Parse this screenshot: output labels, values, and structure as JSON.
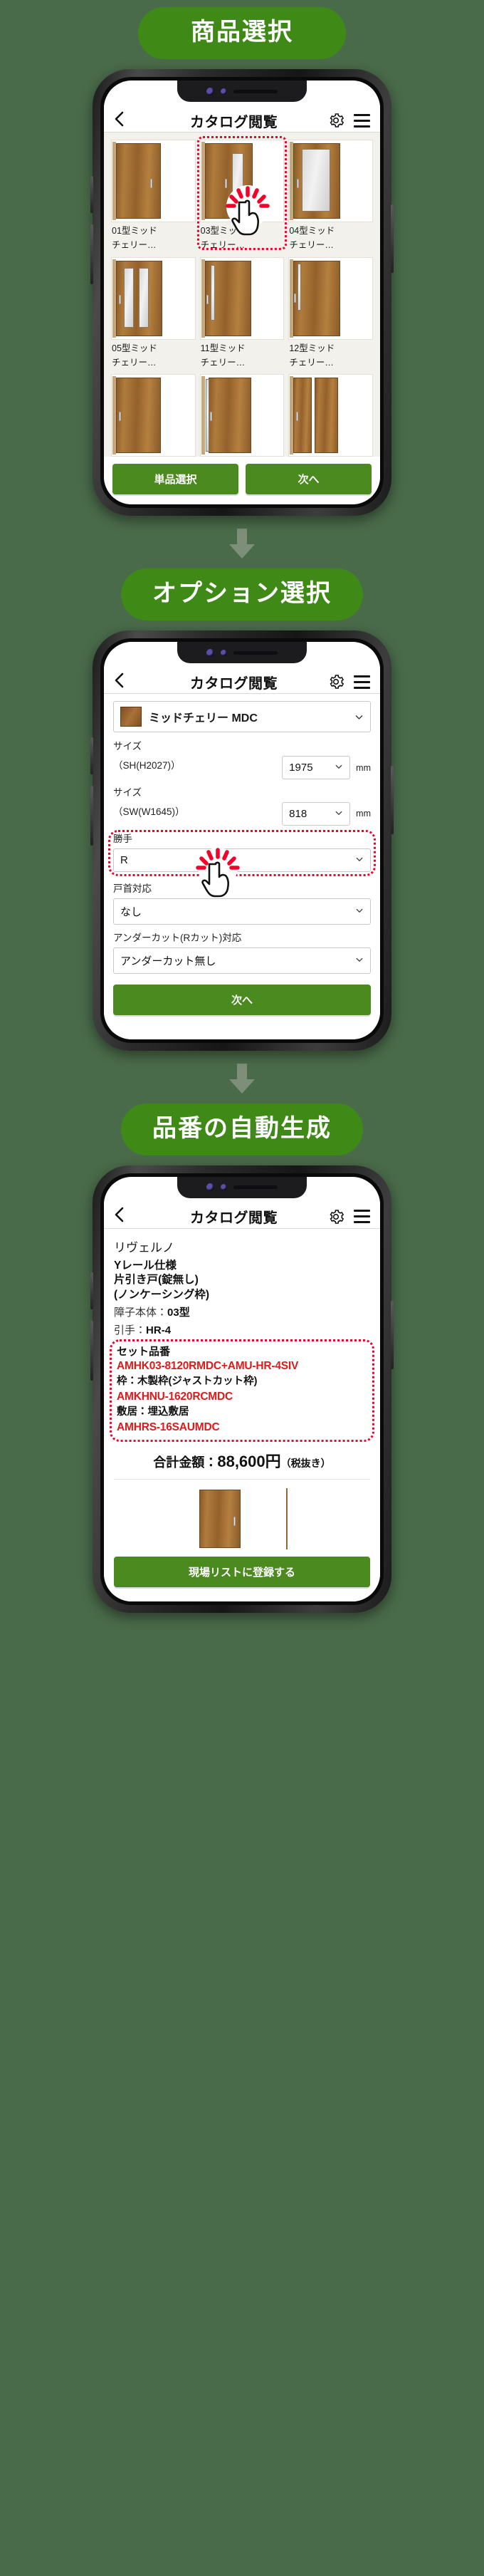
{
  "theme": {
    "banner_green": "#3f8a16",
    "button_green": "#4a8a1e",
    "highlight_red": "#f4002a",
    "code_red": "#e0191b",
    "page_bg": "#4a6b4a"
  },
  "sections": [
    {
      "id": "step1",
      "banner": "商品選択"
    },
    {
      "id": "step2",
      "banner": "オプション選択"
    },
    {
      "id": "step3",
      "banner": "品番の自動生成"
    }
  ],
  "app_header": {
    "back_label": "‹",
    "title": "カタログ閲覧",
    "gear_icon": "gear-icon",
    "menu_icon": "hamburger-menu-icon"
  },
  "screen1": {
    "tiles": [
      {
        "line1": "01型ミッド",
        "line2": "チェリー…",
        "style": "flush",
        "selected": false
      },
      {
        "line1": "03型ミッド",
        "line2": "チェリー…",
        "style": "slim-glass",
        "selected": true
      },
      {
        "line1": "04型ミッド",
        "line2": "チェリー…",
        "style": "big-glass",
        "selected": false
      },
      {
        "line1": "05型ミッド",
        "line2": "チェリー…",
        "style": "twin-glass",
        "selected": false
      },
      {
        "line1": "11型ミッド",
        "line2": "チェリー…",
        "style": "narrow-strip",
        "selected": false
      },
      {
        "line1": "12型ミッド",
        "line2": "チェリー…",
        "style": "edge-strip",
        "selected": false
      },
      {
        "line1": "",
        "line2": "",
        "style": "flush",
        "selected": false
      },
      {
        "line1": "",
        "line2": "",
        "style": "slim-glass",
        "selected": false
      },
      {
        "line1": "",
        "line2": "",
        "style": "twin-glass",
        "selected": false
      }
    ],
    "buttons": {
      "single": "単品選択",
      "next": "次へ"
    },
    "tap_hint_icon": "tap-pointer-icon"
  },
  "screen2": {
    "material": {
      "label": "ミッドチェリー MDC",
      "swatch_icon": "wood-swatch-icon"
    },
    "fields": [
      {
        "name": "height",
        "label_line1": "サイズ",
        "label_line2": "（SH(H2027)）",
        "value": "1975",
        "unit": "mm",
        "inline": true
      },
      {
        "name": "width",
        "label_line1": "サイズ",
        "label_line2": "（SW(W1645)）",
        "value": "818",
        "unit": "mm",
        "inline": true
      },
      {
        "name": "handedness",
        "label_line1": "勝手",
        "label_line2": "",
        "value": "R",
        "unit": "",
        "inline": false,
        "highlight": true
      },
      {
        "name": "door_head",
        "label_line1": "戸首対応",
        "label_line2": "",
        "value": "なし",
        "unit": "",
        "inline": false
      },
      {
        "name": "undercut",
        "label_line1": "アンダーカット(Rカット)対応",
        "label_line2": "",
        "value": "アンダーカット無し",
        "unit": "",
        "inline": false
      }
    ],
    "next_button": "次へ",
    "tap_hint_icon": "tap-pointer-icon"
  },
  "screen3": {
    "brand": "リヴェルノ",
    "spec_lines": [
      "Yレール仕様",
      "片引き戸(錠無し)",
      "(ノンケーシング枠)"
    ],
    "attributes": [
      {
        "label": "障子本体",
        "value": "03型"
      },
      {
        "label": "引手",
        "value": "HR-4"
      }
    ],
    "set_title": "セット品番",
    "set_items": [
      {
        "code": "AMHK03-8120RMDC+AMU-HR-4SIV",
        "sub": "枠：木製枠(ジャストカット枠)"
      },
      {
        "code": "AMKHNU-1620RCMDC",
        "sub": "敷居：埋込敷居"
      },
      {
        "code": "AMHRS-16SAUMDC",
        "sub": ""
      }
    ],
    "total": {
      "label": "合計金額：",
      "amount": "88,600円",
      "tax_note": "（税抜き）"
    },
    "register_button": "現場リストに登録する"
  }
}
